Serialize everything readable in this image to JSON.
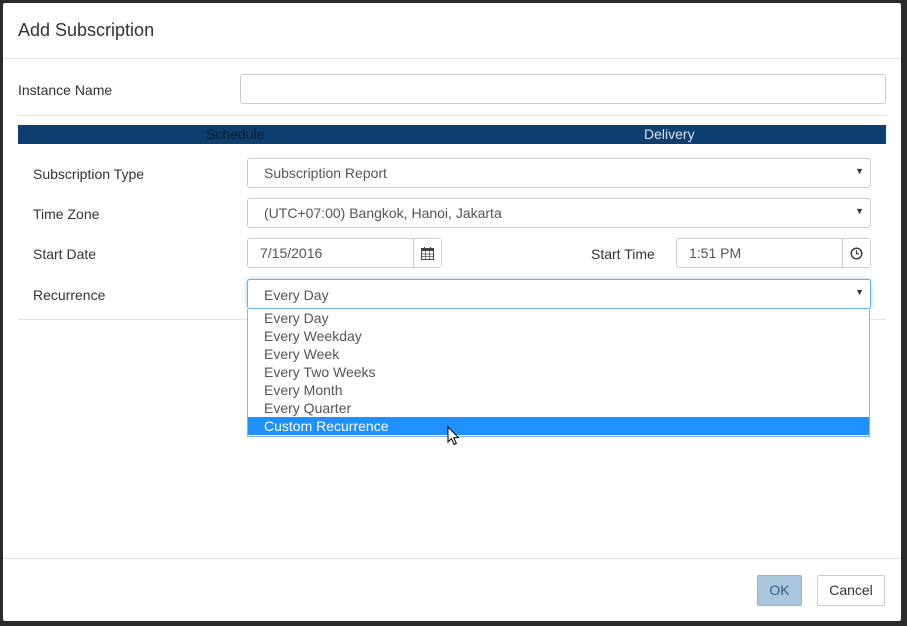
{
  "dialog": {
    "title": "Add Subscription",
    "instance_name": {
      "label": "Instance Name",
      "value": ""
    },
    "tabs": [
      {
        "label": "Schedule",
        "active": true
      },
      {
        "label": "Delivery",
        "active": false
      }
    ],
    "subscription_type": {
      "label": "Subscription Type",
      "value": "Subscription Report"
    },
    "time_zone": {
      "label": "Time Zone",
      "value": "(UTC+07:00) Bangkok, Hanoi, Jakarta"
    },
    "start_date": {
      "label": "Start Date",
      "value": "7/15/2016",
      "icon": "calendar-icon"
    },
    "start_time": {
      "label": "Start Time",
      "value": "1:51 PM",
      "icon": "clock-icon"
    },
    "recurrence": {
      "label": "Recurrence",
      "value": "Every Day",
      "options": [
        "Every Day",
        "Every Weekday",
        "Every Week",
        "Every Two Weeks",
        "Every Month",
        "Every Quarter",
        "Custom Recurrence"
      ],
      "highlighted": "Custom Recurrence"
    },
    "buttons": {
      "ok": "OK",
      "cancel": "Cancel"
    }
  },
  "colors": {
    "tab_bar": "#0d3f70",
    "highlight": "#1e90ff",
    "ok_button": "#a9c6dd"
  }
}
